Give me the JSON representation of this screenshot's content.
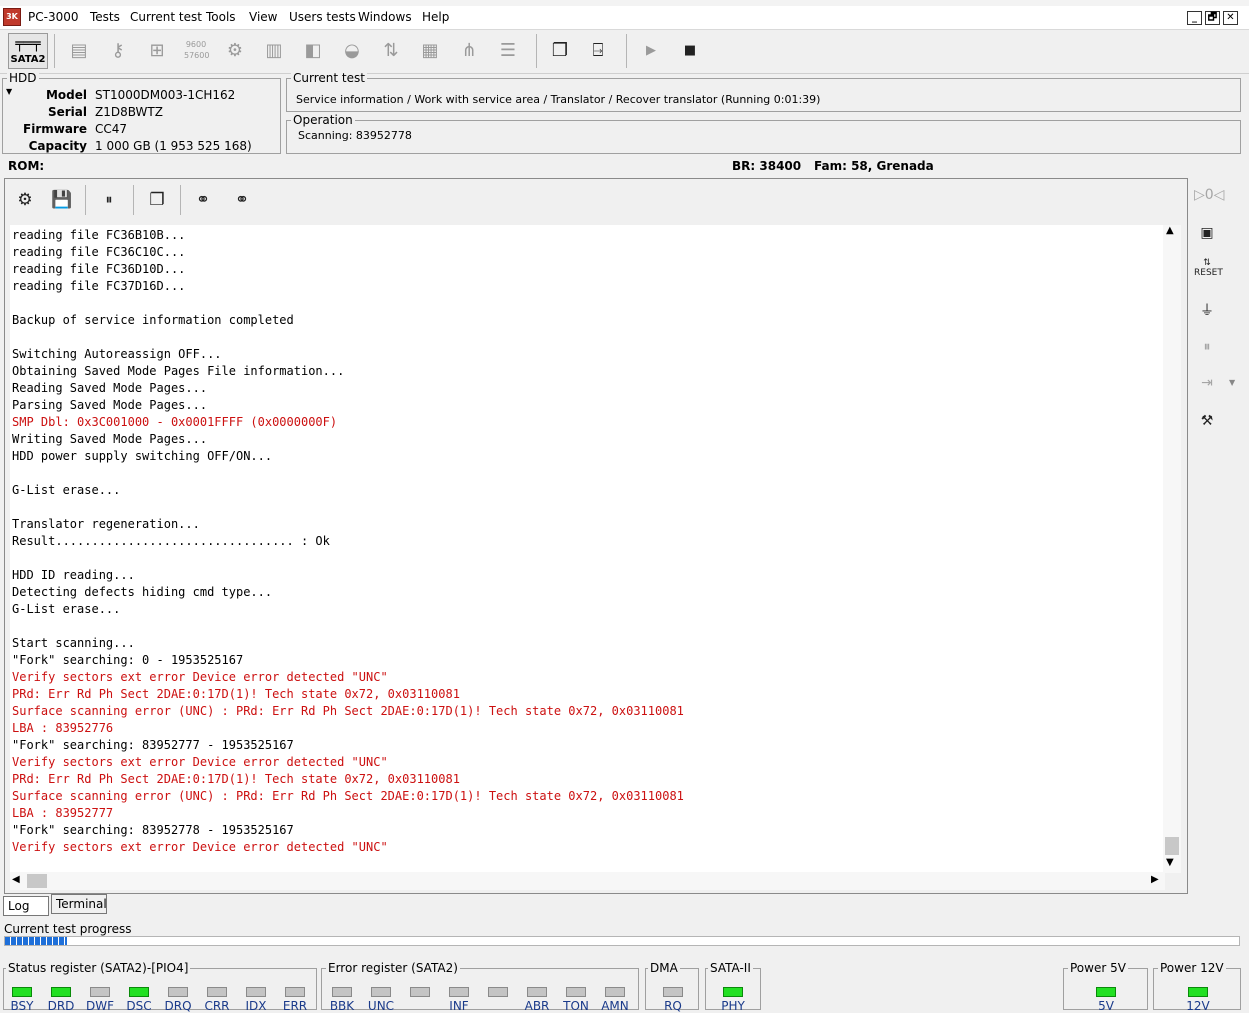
{
  "app": {
    "title": "PC-3000",
    "icon_text": "3K",
    "menu": [
      "PC-3000",
      "Tests",
      "Current test",
      "Tools",
      "View",
      "Users tests",
      "Windows",
      "Help"
    ],
    "mdi_buttons": [
      "_",
      "🗗",
      "✕"
    ]
  },
  "toolbar": {
    "sata2_label": "SATA2",
    "icons": [
      "disk-scan-icon",
      "key-icon",
      "pci-icon",
      "baud-icon",
      "gears-icon",
      "chip-icon",
      "module-icon",
      "head-icon",
      "transfer-icon",
      "grid-icon",
      "network-icon",
      "list-icon",
      "copy-icon",
      "exit-icon",
      "play-icon",
      "stop-icon"
    ]
  },
  "hdd": {
    "title": "HDD",
    "model_label": "Model",
    "model": "ST1000DM003-1CH162",
    "serial_label": "Serial",
    "serial": "Z1D8BWTZ",
    "firmware_label": "Firmware",
    "firmware": "CC47",
    "capacity_label": "Capacity",
    "capacity": "1 000 GB (1 953 525 168)"
  },
  "current_test": {
    "title": "Current test",
    "text": "Service information / Work with service area / Translator / Recover translator (Running 0:01:39)"
  },
  "operation": {
    "title": "Operation",
    "text": "Scanning: 83952778"
  },
  "rom_bar": {
    "rom": "ROM:",
    "br": "BR: 38400",
    "fam": "Fam: 58, Grenada"
  },
  "log": {
    "lines": [
      {
        "t": "reading file FC36B10B...",
        "e": false
      },
      {
        "t": "reading file FC36C10C...",
        "e": false
      },
      {
        "t": "reading file FC36D10D...",
        "e": false
      },
      {
        "t": "reading file FC37D16D...",
        "e": false
      },
      {
        "t": "",
        "e": false
      },
      {
        "t": "Backup of service information completed",
        "e": false
      },
      {
        "t": "",
        "e": false
      },
      {
        "t": "Switching Autoreassign OFF...",
        "e": false
      },
      {
        "t": "Obtaining Saved Mode Pages File information...",
        "e": false
      },
      {
        "t": "Reading Saved Mode Pages...",
        "e": false
      },
      {
        "t": "Parsing Saved Mode Pages...",
        "e": false
      },
      {
        "t": "SMP Dbl: 0x3C001000 - 0x0001FFFF (0x0000000F)",
        "e": true
      },
      {
        "t": "Writing Saved Mode Pages...",
        "e": false
      },
      {
        "t": "HDD power supply switching OFF/ON...",
        "e": false
      },
      {
        "t": "",
        "e": false
      },
      {
        "t": "G-List erase...",
        "e": false
      },
      {
        "t": "",
        "e": false
      },
      {
        "t": "Translator regeneration...",
        "e": false
      },
      {
        "t": "Result................................. : Ok",
        "e": false
      },
      {
        "t": "",
        "e": false
      },
      {
        "t": "HDD ID reading...",
        "e": false
      },
      {
        "t": "Detecting defects hiding cmd type...",
        "e": false
      },
      {
        "t": "G-List erase...",
        "e": false
      },
      {
        "t": "",
        "e": false
      },
      {
        "t": "Start scanning...",
        "e": false
      },
      {
        "t": "\"Fork\" searching: 0 - 1953525167",
        "e": false
      },
      {
        "t": "Verify sectors ext error Device error detected \"UNC\"",
        "e": true
      },
      {
        "t": "PRd: Err Rd Ph Sect 2DAE:0:17D(1)! Tech state 0x72, 0x03110081",
        "e": true
      },
      {
        "t": "Surface scanning error (UNC) : PRd: Err Rd Ph Sect 2DAE:0:17D(1)! Tech state 0x72, 0x03110081",
        "e": true
      },
      {
        "t": "LBA : 83952776",
        "e": true
      },
      {
        "t": "\"Fork\" searching: 83952777 - 1953525167",
        "e": false
      },
      {
        "t": "Verify sectors ext error Device error detected \"UNC\"",
        "e": true
      },
      {
        "t": "PRd: Err Rd Ph Sect 2DAE:0:17D(1)! Tech state 0x72, 0x03110081",
        "e": true
      },
      {
        "t": "Surface scanning error (UNC) : PRd: Err Rd Ph Sect 2DAE:0:17D(1)! Tech state 0x72, 0x03110081",
        "e": true
      },
      {
        "t": "LBA : 83952777",
        "e": true
      },
      {
        "t": "\"Fork\" searching: 83952778 - 1953525167",
        "e": false
      },
      {
        "t": "Verify sectors ext error Device error detected \"UNC\"",
        "e": true
      }
    ]
  },
  "tabs": {
    "log": "Log",
    "terminal": "Terminal"
  },
  "progress": {
    "label": "Current test progress",
    "value_fraction": 0.05
  },
  "status_register": {
    "title": "Status register (SATA2)-[PIO4]",
    "leds": [
      {
        "n": "BSY",
        "on": true
      },
      {
        "n": "DRD",
        "on": true
      },
      {
        "n": "DWF",
        "on": false
      },
      {
        "n": "DSC",
        "on": true
      },
      {
        "n": "DRQ",
        "on": false
      },
      {
        "n": "CRR",
        "on": false
      },
      {
        "n": "IDX",
        "on": false
      },
      {
        "n": "ERR",
        "on": false
      }
    ]
  },
  "error_register": {
    "title": "Error register (SATA2)",
    "leds": [
      {
        "n": "BBK",
        "on": false
      },
      {
        "n": "UNC",
        "on": false
      },
      {
        "n": "",
        "on": false
      },
      {
        "n": "INF",
        "on": false
      },
      {
        "n": "",
        "on": false
      },
      {
        "n": "ABR",
        "on": false
      },
      {
        "n": "TON",
        "on": false
      },
      {
        "n": "AMN",
        "on": false
      }
    ]
  },
  "dma": {
    "title": "DMA",
    "leds": [
      {
        "n": "RQ",
        "on": false
      }
    ]
  },
  "sata2": {
    "title": "SATA-II",
    "leds": [
      {
        "n": "PHY",
        "on": true
      }
    ]
  },
  "power5": {
    "title": "Power 5V",
    "leds": [
      {
        "n": "5V",
        "on": true
      }
    ]
  },
  "power12": {
    "title": "Power 12V",
    "leds": [
      {
        "n": "12V",
        "on": true
      }
    ]
  }
}
